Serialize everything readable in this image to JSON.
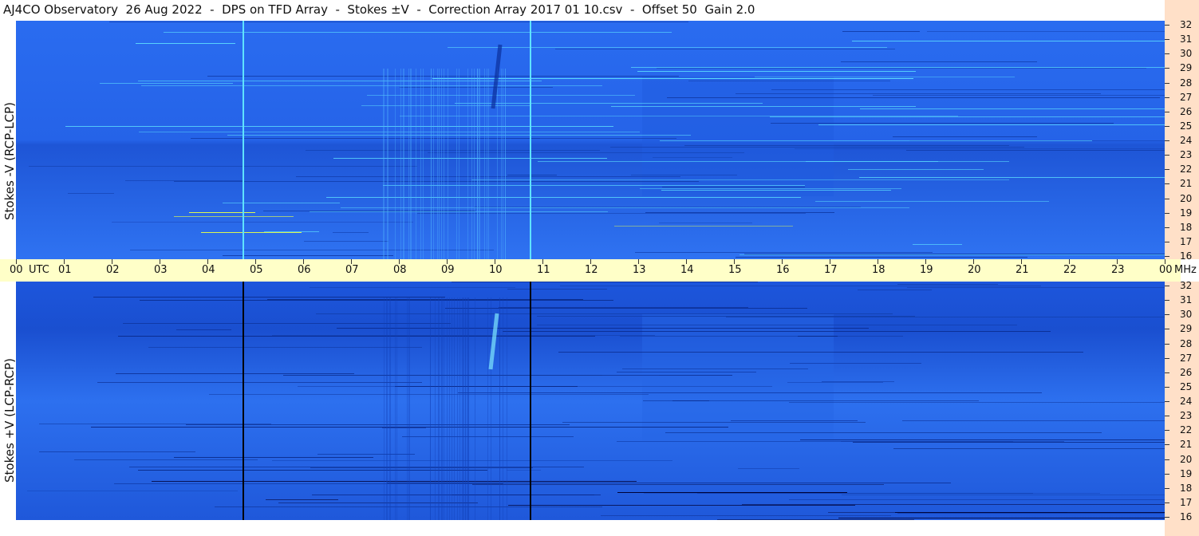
{
  "title": "AJ4CO Observatory  26 Aug 2022  -  DPS on TFD Array  -  Stokes ±V  -  Correction Array 2017 01 10.csv  -  Offset 50  Gain 2.0",
  "colors": {
    "background_deep": "#1a4fd8",
    "background_mid": "#2a6cf0",
    "timebar": "#ffffc8",
    "freqbar": "#ffe0c8",
    "highlight_cyan": "#5fe3ff",
    "highlight_yellow": "#e6ff4a",
    "dark_line": "#000033"
  },
  "chart_data": [
    {
      "type": "heatmap",
      "name": "top-panel",
      "ylabel": "Stokes -V (RCP-LCP)",
      "x_ticks": [
        "00",
        "UTC",
        "01",
        "02",
        "03",
        "04",
        "05",
        "06",
        "07",
        "08",
        "09",
        "10",
        "11",
        "12",
        "13",
        "14",
        "15",
        "16",
        "17",
        "18",
        "19",
        "20",
        "21",
        "22",
        "23",
        "00",
        "MHz"
      ],
      "y_ticks": [
        "32",
        "31",
        "30",
        "29",
        "28",
        "27",
        "26",
        "25",
        "24",
        "23",
        "22",
        "21",
        "20",
        "19",
        "18",
        "17",
        "16"
      ],
      "ylim": [
        16,
        32
      ],
      "xlim_hours_utc": [
        0,
        24
      ]
    },
    {
      "type": "heatmap",
      "name": "bottom-panel",
      "ylabel": "Stokes +V (LCP-RCP)",
      "y_ticks": [
        "32",
        "31",
        "30",
        "29",
        "28",
        "27",
        "26",
        "25",
        "24",
        "23",
        "22",
        "21",
        "20",
        "19",
        "18",
        "17",
        "16"
      ],
      "ylim": [
        16,
        32
      ],
      "xlim_hours_utc": [
        0,
        24
      ]
    }
  ]
}
